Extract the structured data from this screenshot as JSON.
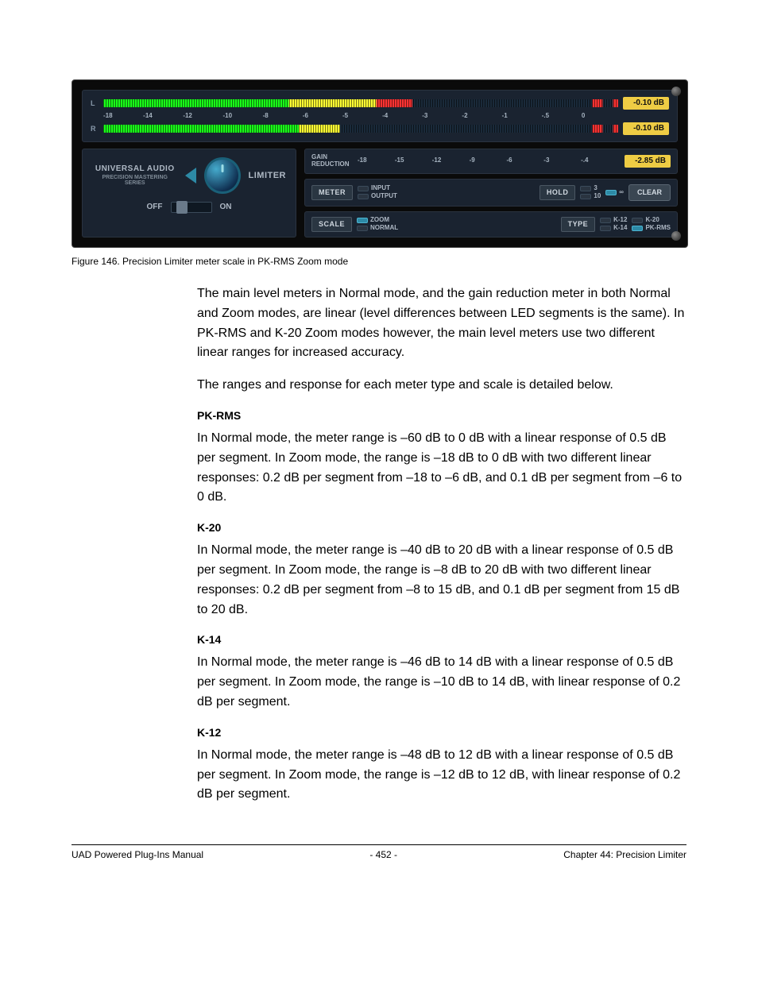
{
  "ui": {
    "meters": {
      "L_label": "L",
      "R_label": "R",
      "readout_L": "-0.10 dB",
      "readout_R": "-0.10 dB",
      "ticks": [
        "-18",
        "-14",
        "-12",
        "-10",
        "-8",
        "-6",
        "-5",
        "-4",
        "-3",
        "-2",
        "-1",
        "-.5",
        "0"
      ]
    },
    "left": {
      "brand_top": "UNIVERSAL AUDIO",
      "brand_sub": "PRECISION MASTERING SERIES",
      "limiter_label": "LIMITER",
      "off_label": "OFF",
      "on_label": "ON"
    },
    "gr": {
      "label": "GAIN REDUCTION",
      "readout": "-2.85 dB",
      "ticks": [
        "-18",
        "-15",
        "-12",
        "-9",
        "-6",
        "-3",
        "-.4"
      ]
    },
    "controls": {
      "meter_btn": "METER",
      "meter_opt1": "INPUT",
      "meter_opt2": "OUTPUT",
      "hold_btn": "HOLD",
      "hold_opt1": "3",
      "hold_opt2": "10",
      "hold_opt3": "∞",
      "clear_btn": "CLEAR",
      "scale_btn": "SCALE",
      "scale_opt1": "ZOOM",
      "scale_opt2": "NORMAL",
      "type_btn": "TYPE",
      "type_opt1": "K-12",
      "type_opt2": "K-14",
      "type_opt3": "K-20",
      "type_opt4": "PK-RMS"
    }
  },
  "figure_caption": "Figure 146.  Precision Limiter meter scale in PK-RMS Zoom mode",
  "body": {
    "p1": "The main level meters in Normal mode, and the gain reduction meter in both Normal and Zoom modes, are linear (level differences between LED segments is the same). In PK-RMS and K-20 Zoom modes however, the main level meters use two different linear ranges for increased accuracy.",
    "p2": "The ranges and response for each meter type and scale is detailed below.",
    "h_pkrms": "PK-RMS",
    "p_pkrms": "In Normal mode, the meter range is –60 dB to 0 dB with a linear response of 0.5 dB per segment. In Zoom mode, the range is –18 dB to 0 dB with two different linear responses: 0.2 dB per segment from –18 to –6 dB, and 0.1 dB per segment from –6 to 0 dB.",
    "h_k20": "K-20",
    "p_k20": "In Normal mode, the meter range is –40 dB to 20 dB with a linear response of 0.5 dB per segment. In Zoom mode, the range is –8 dB to 20 dB with two different linear responses: 0.2 dB per segment from –8 to 15 dB, and 0.1 dB per segment from 15 dB to 20 dB.",
    "h_k14": "K-14",
    "p_k14": "In Normal mode, the meter range is –46 dB to 14 dB with a linear response of 0.5 dB per segment. In Zoom mode, the range is –10 dB to 14 dB, with linear response of 0.2 dB per segment.",
    "h_k12": "K-12",
    "p_k12": "In Normal mode, the meter range is –48 dB to 12 dB with a linear response of 0.5 dB per segment. In Zoom mode, the range is –12 dB to 12 dB, with linear response of 0.2 dB per segment."
  },
  "footer": {
    "left": "UAD Powered Plug-Ins Manual",
    "center": "- 452 -",
    "right": "Chapter 44: Precision Limiter"
  }
}
